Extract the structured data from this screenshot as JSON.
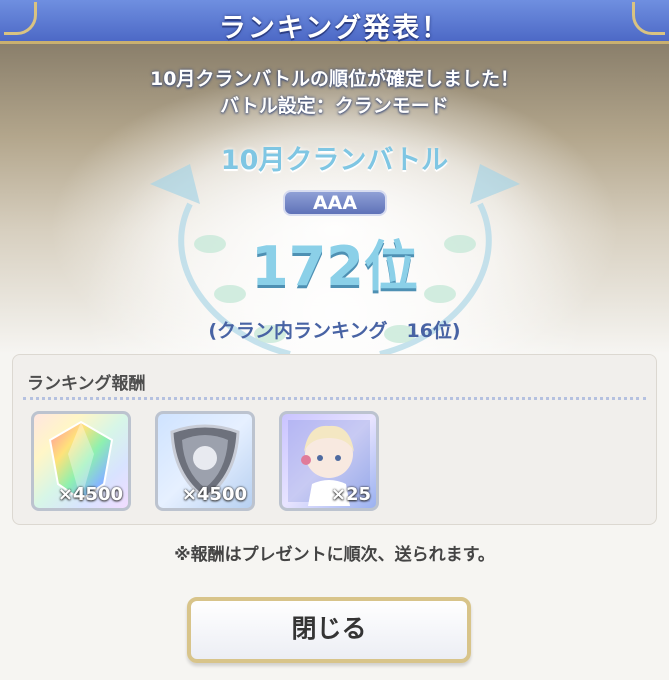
{
  "header": {
    "title": "ランキング発表！"
  },
  "announcement": {
    "line1": "10月クランバトルの順位が確定しました！",
    "line2": "バトル設定：クランモード"
  },
  "result": {
    "battle_name": "10月クランバトル",
    "tier_badge": "AAA",
    "rank": "172位",
    "clan_rank": "(クラン内ランキング　16位)"
  },
  "rewards": {
    "heading": "ランキング報酬",
    "items": [
      {
        "icon": "rainbow-crystal-icon",
        "count": "×4500"
      },
      {
        "icon": "silver-medal-icon",
        "count": "×4500"
      },
      {
        "icon": "character-portrait-icon",
        "count": "×25"
      }
    ]
  },
  "note": "※報酬はプレゼントに順次、送られます。",
  "close_button": {
    "label": "閉じる"
  },
  "colors": {
    "header": "#5a78d2",
    "accent_gold": "#d8c48a",
    "rank_blue": "#8bd0e8"
  }
}
